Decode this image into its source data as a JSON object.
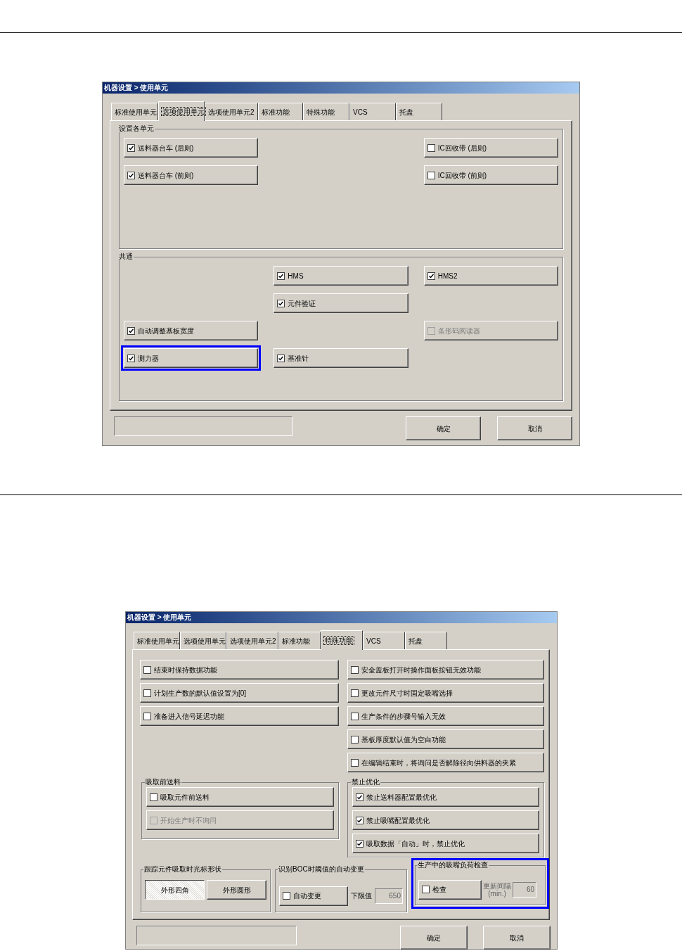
{
  "dialogs": [
    {
      "title": "机器设置 > 使用单元",
      "tabs": [
        {
          "label": "标准使用单元",
          "selected": false
        },
        {
          "label": "选项使用单元",
          "selected": true
        },
        {
          "label": "选项使用单元2",
          "selected": false
        },
        {
          "label": "标准功能",
          "selected": false
        },
        {
          "label": "特殊功能",
          "selected": false
        },
        {
          "label": "VCS",
          "selected": false
        },
        {
          "label": "托盘",
          "selected": false
        }
      ],
      "groups": [
        {
          "label": "设置各单元",
          "items": [
            {
              "label": "送料器台车 (后则)",
              "checked": true,
              "disabled": false,
              "highlighted": false
            },
            {
              "label": "IC回收带 (后则)",
              "checked": false,
              "disabled": false,
              "highlighted": false
            },
            {
              "label": "送料器台车 (前则)",
              "checked": true,
              "disabled": false,
              "highlighted": false
            },
            {
              "label": "IC回收带 (前则)",
              "checked": false,
              "disabled": false,
              "highlighted": false
            }
          ]
        },
        {
          "label": "共通",
          "items": [
            {
              "label": "HMS",
              "checked": true,
              "disabled": false,
              "highlighted": false
            },
            {
              "label": "HMS2",
              "checked": true,
              "disabled": false,
              "highlighted": false
            },
            {
              "label": "元件验证",
              "checked": true,
              "disabled": false,
              "highlighted": false
            },
            {
              "label": "自动调整基板宽度",
              "checked": true,
              "disabled": false,
              "highlighted": false
            },
            {
              "label": "条形码阅读器",
              "checked": false,
              "disabled": true,
              "highlighted": false
            },
            {
              "label": "测力器",
              "checked": true,
              "disabled": false,
              "highlighted": true
            },
            {
              "label": "基准针",
              "checked": true,
              "disabled": false,
              "highlighted": false
            }
          ]
        }
      ],
      "buttons": [
        "确定",
        "取消"
      ]
    },
    {
      "title": "机器设置 > 使用单元",
      "tabs": [
        {
          "label": "标准使用单元",
          "selected": false
        },
        {
          "label": "选项使用单元",
          "selected": false
        },
        {
          "label": "选项使用单元2",
          "selected": false
        },
        {
          "label": "标准功能",
          "selected": false
        },
        {
          "label": "特殊功能",
          "selected": true
        },
        {
          "label": "VCS",
          "selected": false
        },
        {
          "label": "托盘",
          "selected": false
        }
      ],
      "left_options": [
        {
          "label": "结束时保持数据功能",
          "checked": false,
          "disabled": false
        },
        {
          "label": "计划生产数的默认值设置为[0]",
          "checked": false,
          "disabled": false
        },
        {
          "label": "准备进入信号延迟功能",
          "checked": false,
          "disabled": false
        }
      ],
      "right_options": [
        {
          "label": "安全盖板打开时操作面板按钮无效功能",
          "checked": false,
          "disabled": false
        },
        {
          "label": "更改元件尺寸时固定吸嘴选择",
          "checked": false,
          "disabled": false
        },
        {
          "label": "生产条件的步骤号输入无效",
          "checked": false,
          "disabled": false
        },
        {
          "label": "基板厚度默认值为空白功能",
          "checked": false,
          "disabled": false
        },
        {
          "label": "在编辑结束时，将询问是否解除径向供料器的夹紧",
          "checked": false,
          "disabled": false
        }
      ],
      "feed_group": {
        "label": "吸取前送料",
        "items": [
          {
            "label": "吸取元件前送料",
            "checked": false,
            "disabled": false
          },
          {
            "label": "开始生产时不询问",
            "checked": false,
            "disabled": true
          }
        ]
      },
      "optimize_group": {
        "label": "禁止优化",
        "items": [
          {
            "label": "禁止送料器配置最优化",
            "checked": true,
            "disabled": false
          },
          {
            "label": "禁止吸嘴配置最优化",
            "checked": true,
            "disabled": false
          },
          {
            "label": "吸取数据「自动」时，禁止优化",
            "checked": true,
            "disabled": false
          }
        ]
      },
      "cursor_group": {
        "label": "跟踪元件吸取时光标形状",
        "buttons": [
          {
            "label": "外形四角",
            "selected": true
          },
          {
            "label": "外形圆形",
            "selected": false
          }
        ]
      },
      "boc_group": {
        "label": "识别BOC时阈值的自动变更",
        "checkbox": {
          "label": "自动变更",
          "checked": false,
          "disabled": false
        },
        "limit_label": "下限值",
        "limit_value": "650"
      },
      "load_group": {
        "label": "生产中的吸嘴负荷检查",
        "highlighted": true,
        "checkbox": {
          "label": "检查",
          "checked": false,
          "disabled": false
        },
        "interval_label": "更新间隔",
        "interval_unit": "(min.)",
        "interval_value": "60"
      },
      "buttons": [
        "确定",
        "取消"
      ]
    }
  ]
}
